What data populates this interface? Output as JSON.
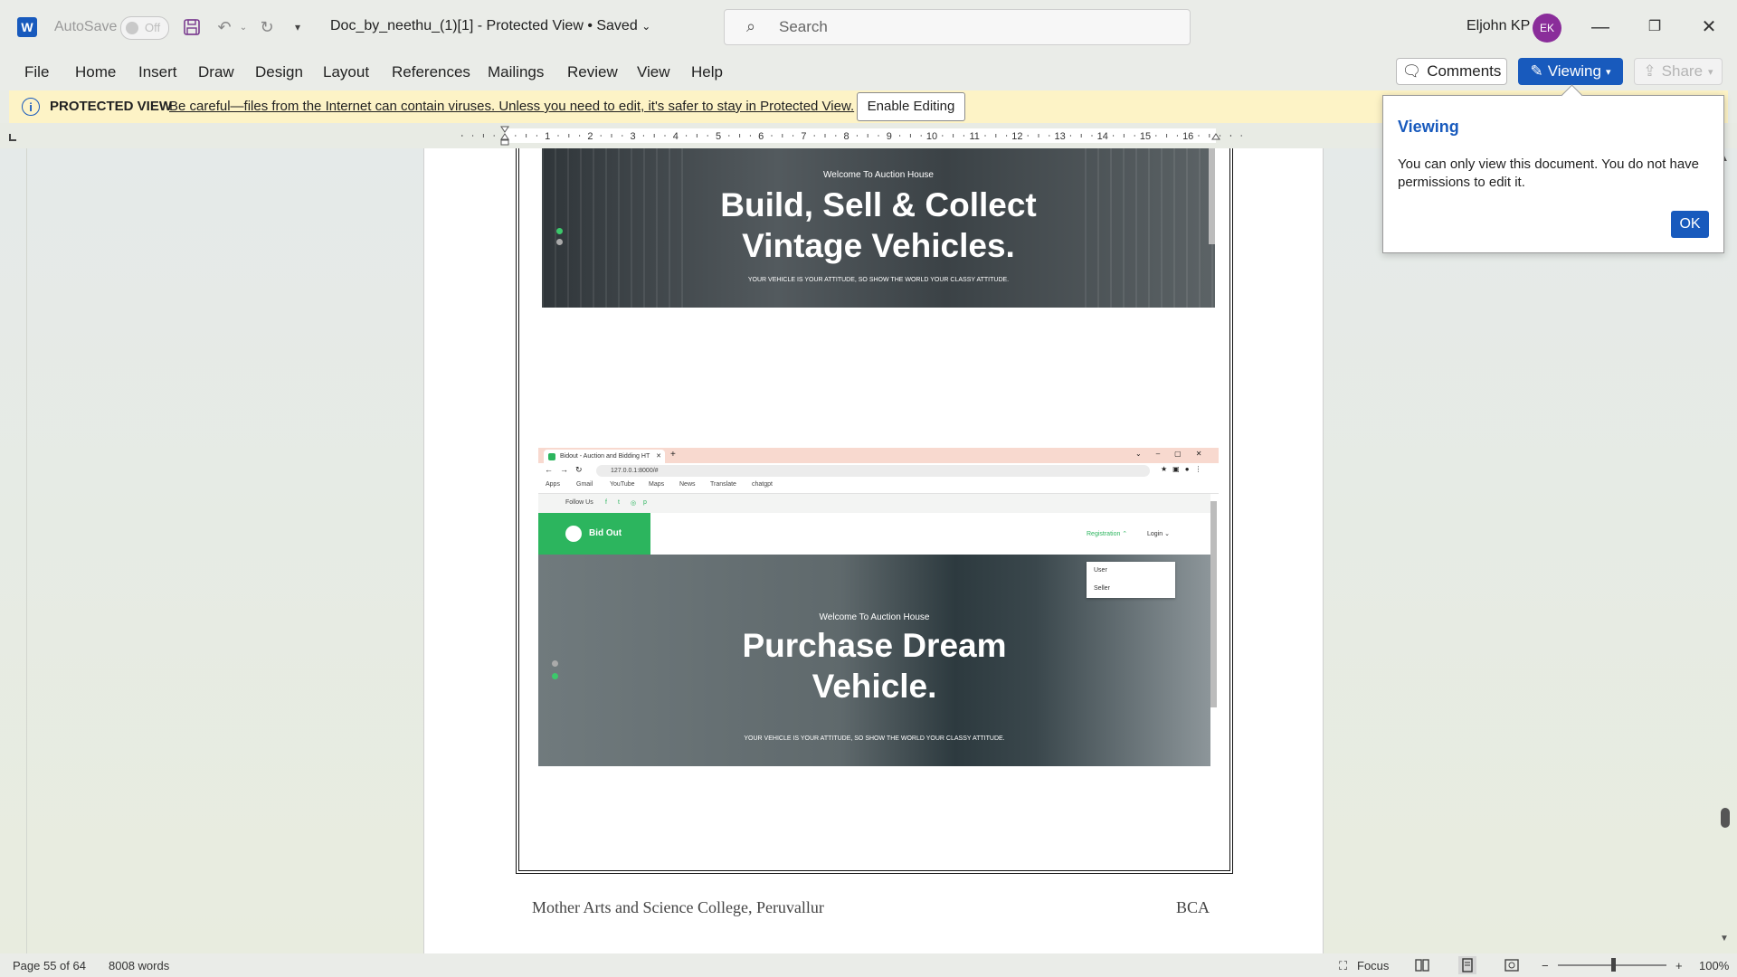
{
  "titlebar": {
    "autosave_label": "AutoSave",
    "autosave_state": "Off",
    "doc_title": "Doc_by_neethu_(1)[1]  -  Protected View • Saved",
    "search_placeholder": "Search",
    "user_name": "Eljohn KP",
    "user_initials": "EK",
    "icons": [
      "word-logo-icon",
      "save-icon",
      "undo-icon",
      "redo-icon",
      "customize-qat-icon",
      "search-icon",
      "minimize-icon",
      "restore-icon",
      "close-icon"
    ]
  },
  "ribbon": {
    "tabs": [
      "File",
      "Home",
      "Insert",
      "Draw",
      "Design",
      "Layout",
      "References",
      "Mailings",
      "Review",
      "View",
      "Help"
    ],
    "comments_label": "Comments",
    "viewing_label": "Viewing",
    "share_label": "Share"
  },
  "protected_view": {
    "label": "PROTECTED VIEW",
    "message": "Be careful—files from the Internet can contain viruses. Unless you need to edit, it's safer to stay in Protected View.",
    "enable_label": "Enable Editing"
  },
  "ruler": {
    "numbers": [
      "1",
      "2",
      "3",
      "4",
      "5",
      "6",
      "7",
      "8",
      "9",
      "10",
      "11",
      "12",
      "13",
      "14",
      "15",
      "16"
    ]
  },
  "document": {
    "screenshot1": {
      "welcome": "Welcome To Auction House",
      "headline_line1": "Build, Sell & Collect",
      "headline_line2": "Vintage Vehicles.",
      "tagline": "YOUR VEHICLE IS YOUR ATTITUDE, SO SHOW THE WORLD YOUR CLASSY ATTITUDE."
    },
    "screenshot2": {
      "tab_title": "Bidout - Auction and Bidding HT",
      "url": "127.0.0.1:8000/#",
      "bookmarks": [
        "Apps",
        "Gmail",
        "YouTube",
        "Maps",
        "News",
        "Translate",
        "chatgpt"
      ],
      "follow_label": "Follow Us",
      "social": [
        "f",
        "t",
        "◎",
        "p"
      ],
      "logo_text": "Bid Out",
      "nav_registration": "Registration ⌃",
      "nav_login": "Login ⌄",
      "dropdown_items": [
        "User",
        "Seller"
      ],
      "welcome": "Welcome To Auction House",
      "headline_line1": "Purchase Dream",
      "headline_line2": "Vehicle.",
      "tagline": "YOUR VEHICLE IS YOUR ATTITUDE, SO SHOW THE WORLD YOUR CLASSY ATTITUDE."
    },
    "footer_left": "Mother Arts and Science College, Peruvallur",
    "footer_right": "BCA"
  },
  "popup": {
    "title": "Viewing",
    "body": "You can only view this document. You do not have permissions to edit it.",
    "ok_label": "OK"
  },
  "status": {
    "page": "Page 55 of 64",
    "words": "8008 words",
    "focus_label": "Focus",
    "zoom": "100%",
    "colors": {
      "accent": "#185abd",
      "avatar": "#8a2d9a",
      "brand_green": "#2cb55e",
      "banner": "#fdf3c6"
    }
  }
}
